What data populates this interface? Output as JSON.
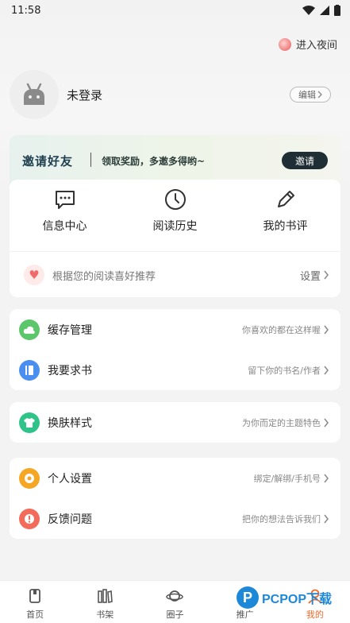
{
  "status_bar": {
    "time": "11:58"
  },
  "header": {
    "night_mode_label": "进入夜间"
  },
  "profile": {
    "name": "未登录",
    "edit_label": "编辑"
  },
  "invite": {
    "title": "邀请好友",
    "subtitle": "领取奖励，多邀多得哟~",
    "button_label": "邀请"
  },
  "quick_actions": [
    {
      "label": "信息中心",
      "icon": "message-icon"
    },
    {
      "label": "阅读历史",
      "icon": "clock-icon"
    },
    {
      "label": "我的书评",
      "icon": "pen-icon"
    }
  ],
  "recommend": {
    "text": "根据您的阅读喜好推荐",
    "action_label": "设置"
  },
  "menu_group_1": [
    {
      "label": "缓存管理",
      "hint": "你喜欢的都在这样喔",
      "icon": "cloud-icon",
      "color": "#5cc66b"
    },
    {
      "label": "我要求书",
      "hint": "留下你的书名/作者",
      "icon": "book-icon",
      "color": "#4a8ff0"
    }
  ],
  "menu_group_2": [
    {
      "label": "换肤样式",
      "hint": "为你而定的主题特色",
      "icon": "shirt-icon",
      "color": "#2fc38a"
    }
  ],
  "menu_group_3": [
    {
      "label": "个人设置",
      "hint": "绑定/解绑/手机号",
      "icon": "settings-icon",
      "color": "#f5a623"
    },
    {
      "label": "反馈问题",
      "hint": "把你的想法告诉我们",
      "icon": "alert-icon",
      "color": "#f26b5b"
    }
  ],
  "tabs": [
    {
      "label": "首页",
      "icon": "home-icon"
    },
    {
      "label": "书架",
      "icon": "bookshelf-icon"
    },
    {
      "label": "圈子",
      "icon": "planet-icon"
    },
    {
      "label": "推广",
      "icon": "promote-icon"
    },
    {
      "label": "我的",
      "icon": "profile-icon",
      "active": true
    }
  ],
  "watermark": {
    "text": "PCPOP下载",
    "logo": "P"
  },
  "colors": {
    "accent": "#f06a2a",
    "invite_button": "#1f2e35"
  }
}
